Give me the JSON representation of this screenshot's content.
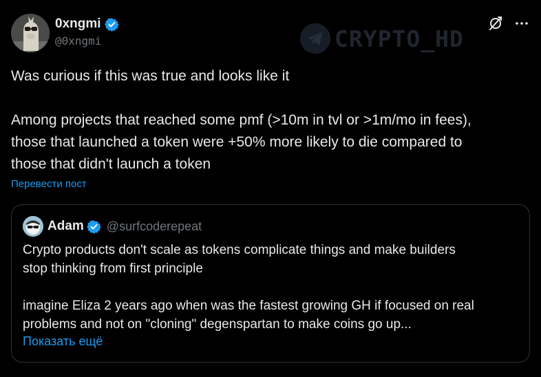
{
  "author": {
    "display_name": "0xngmi",
    "handle": "@0xngmi",
    "verified": true
  },
  "watermark": {
    "text": "CRYPTO_HD",
    "icon": "telegram-icon"
  },
  "actions": {
    "grok_icon": "grok-icon",
    "more_icon": "more-horizontal-icon"
  },
  "tweet": {
    "line1": "Was curious if this was true and looks like it",
    "paragraph2": "Among projects that reached some pmf (>10m in tvl or >1m/mo in fees),\nthose that launched a token were +50% more likely to die compared to\nthose that didn't launch a token",
    "translate_label": "Перевести пост"
  },
  "quote": {
    "display_name": "Adam",
    "handle": "@surfcoderepeat",
    "verified": true,
    "paragraph1": "Crypto products don't scale as tokens complicate things and make builders\nstop thinking from first principle",
    "paragraph2": "imagine Eliza 2 years ago when was the fastest growing GH if focused on real\nproblems and not on \"cloning\" degenspartan to make coins go up...",
    "show_more_label": "Показать ещё"
  },
  "colors": {
    "background": "#000000",
    "text": "#e7e9ea",
    "secondary": "#71767b",
    "link": "#1d9bf0",
    "border": "#2f3336"
  }
}
